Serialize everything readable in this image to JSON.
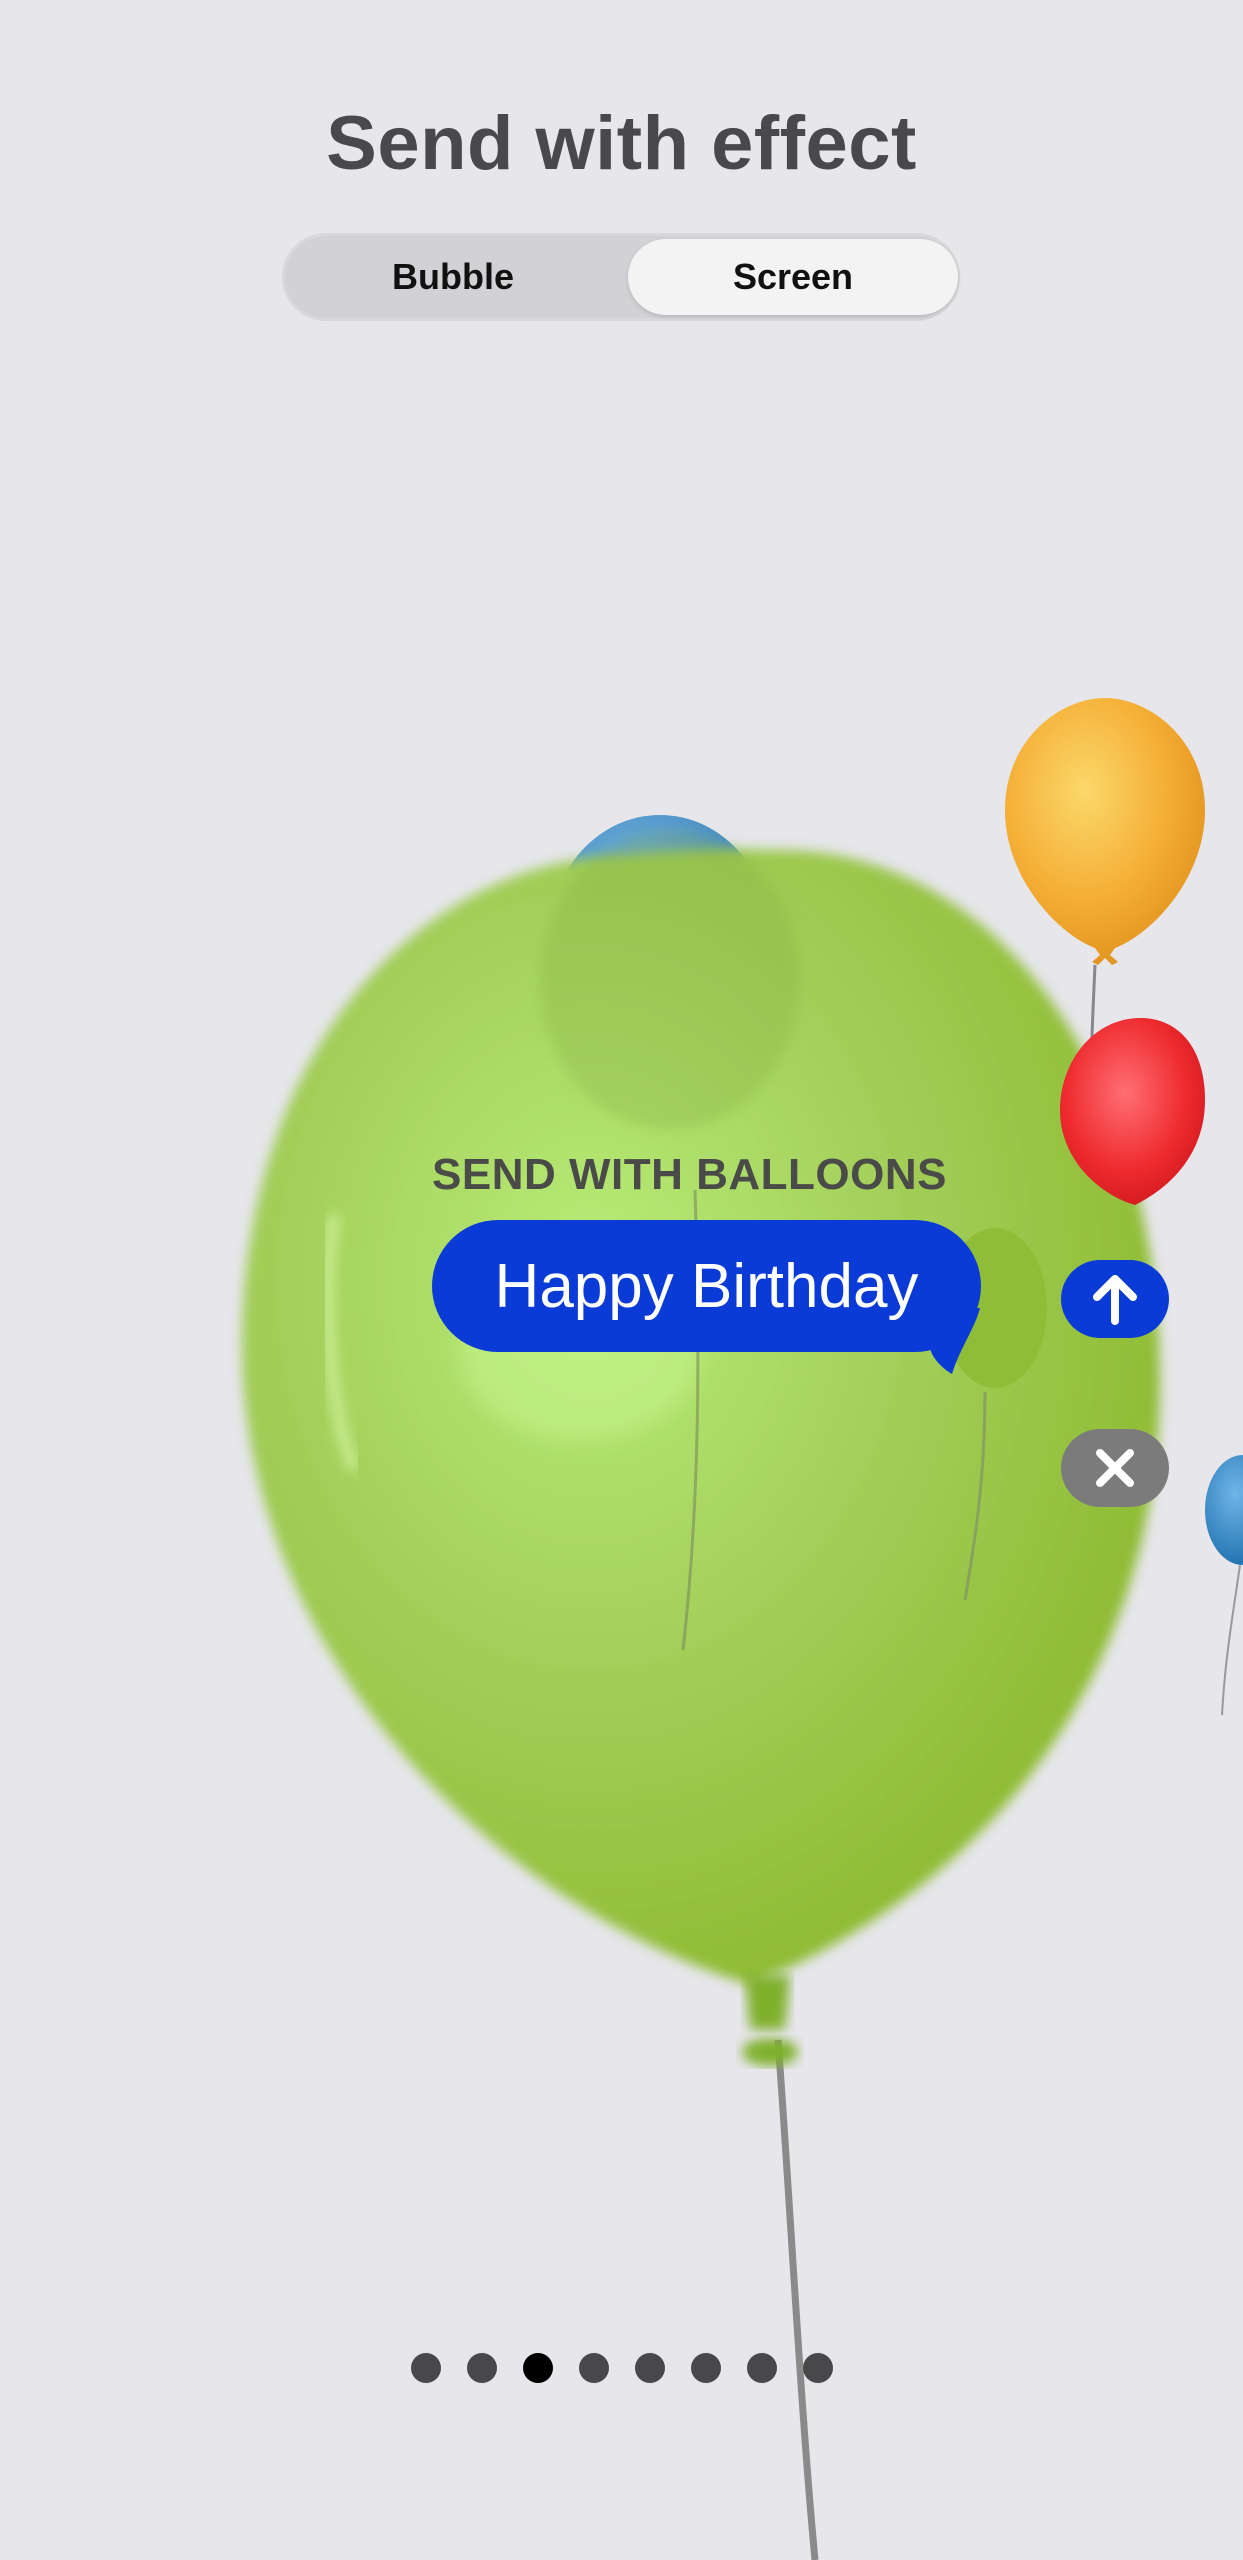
{
  "header": {
    "title": "Send with effect"
  },
  "segmented_control": {
    "options": [
      "Bubble",
      "Screen"
    ],
    "selected": "Screen"
  },
  "effect": {
    "label": "SEND WITH BALLOONS"
  },
  "message": {
    "text": "Happy Birthday",
    "bubble_color": "#0a3bd6"
  },
  "actions": {
    "send_icon": "arrow-up-icon",
    "cancel_icon": "close-icon"
  },
  "pager": {
    "count": 8,
    "active_index": 2
  },
  "colors": {
    "background": "#e6e6eb",
    "accent": "#0a3bd6",
    "balloon_green": "#9ac73a",
    "balloon_yellow": "#f2a82c",
    "balloon_red": "#ee2a2e",
    "balloon_blue": "#2f86c8"
  }
}
